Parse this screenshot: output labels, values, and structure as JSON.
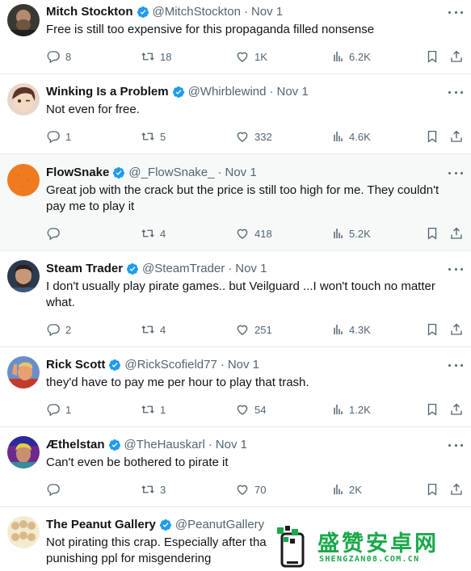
{
  "tweets": [
    {
      "name": "Mitch Stockton",
      "handle": "@MitchStockton",
      "sep": "·",
      "date": "Nov 1",
      "text": "Free is still too expensive for this propaganda filled nonsense",
      "replies": "8",
      "reposts": "18",
      "likes": "1K",
      "views": "6.2K",
      "avatar_color": "#3b3834"
    },
    {
      "name": "Winking Is a Problem",
      "handle": "@Whirblewind",
      "sep": "·",
      "date": "Nov 1",
      "text": "Not even for free.",
      "replies": "1",
      "reposts": "5",
      "likes": "332",
      "views": "4.6K",
      "avatar_color": "#c9a48c"
    },
    {
      "name": "FlowSnake",
      "handle": "@_FlowSnake_",
      "sep": "·",
      "date": "Nov 1",
      "text": "Great job with the crack but the price is still too high for me. They couldn't pay me to play it",
      "replies": "",
      "reposts": "4",
      "likes": "418",
      "views": "5.2K",
      "avatar_color": "#f07a1f"
    },
    {
      "name": "Steam Trader",
      "handle": "@SteamTrader",
      "sep": "·",
      "date": "Nov 1",
      "text": "I don't usually play pirate games.. but Veilguard ...I won't touch no matter what.",
      "replies": "2",
      "reposts": "4",
      "likes": "251",
      "views": "4.3K",
      "avatar_color": "#2c3a4e"
    },
    {
      "name": "Rick Scott",
      "handle": "@RickScofield77",
      "sep": "·",
      "date": "Nov 1",
      "text": "they'd have to pay me per hour to play that trash.",
      "replies": "1",
      "reposts": "1",
      "likes": "54",
      "views": "1.2K",
      "avatar_color": "#6a8fc8"
    },
    {
      "name": "Æthelstan",
      "handle": "@TheHauskarl",
      "sep": "·",
      "date": "Nov 1",
      "text": "Can't even be bothered to pirate it",
      "replies": "",
      "reposts": "3",
      "likes": "70",
      "views": "2K",
      "avatar_color": "#6b2a8c"
    },
    {
      "name": "The Peanut Gallery",
      "handle": "@PeanutGallery",
      "sep": "",
      "date": "",
      "text": "Not pirating this crap. Especially after tha punishing ppl for misgendering",
      "avatar_color": "#e8d9b0"
    }
  ],
  "icons": [
    "verified-badge-icon",
    "reply-icon",
    "repost-icon",
    "like-icon",
    "views-icon",
    "bookmark-icon",
    "share-icon",
    "more-icon"
  ],
  "colors": {
    "verified": "#1d9bf0",
    "muted": "#536471",
    "text": "#0f1419",
    "watermark": "#1aa84a",
    "highlight_row": "#f7f9f9"
  },
  "watermark": {
    "title": "盛赞安卓网",
    "subtitle": "SHENGZAN08.COM.CN"
  }
}
